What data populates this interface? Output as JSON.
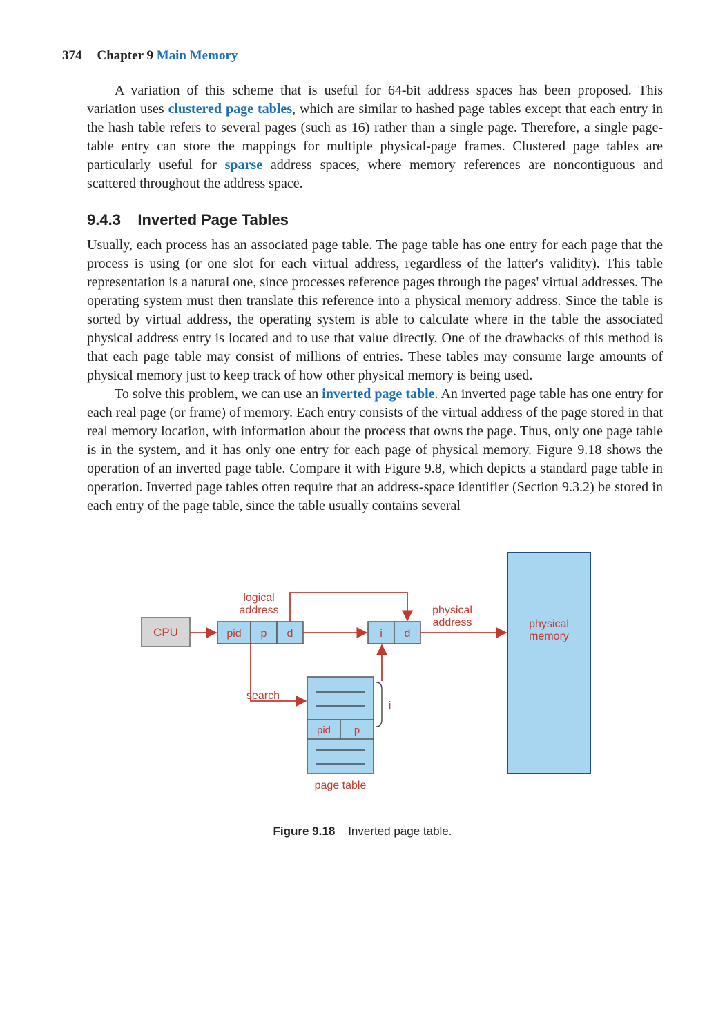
{
  "header": {
    "page_number": "374",
    "chapter_label": "Chapter 9",
    "chapter_title": "Main Memory"
  },
  "para1": {
    "t1": "A variation of this scheme that is useful for 64-bit address spaces has been proposed. This variation uses ",
    "term1": "clustered page tables",
    "t2": ", which are similar to hashed page tables except that each entry in the hash table refers to several pages (such as 16) rather than a single page. Therefore, a single page-table entry can store the mappings for multiple physical-page frames. Clustered page tables are particularly useful for ",
    "term2": "sparse",
    "t3": " address spaces, where memory references are noncontiguous and scattered throughout the address space."
  },
  "section": {
    "number": "9.4.3",
    "title": "Inverted Page Tables"
  },
  "para2": {
    "t1": "Usually, each process has an associated page table. The page table has one entry for each page that the process is using (or one slot for each virtual address, regardless of the latter's validity). This table representation is a natural one, since processes reference pages through the pages' virtual addresses. The operating system must then translate this reference into a physical memory address. Since the table is sorted by virtual address, the operating system is able to calculate where in the table the associated physical address entry is located and to use that value directly. One of the drawbacks of this method is that each page table may consist of millions of entries. These tables may consume large amounts of physical memory just to keep track of how other physical memory is being used."
  },
  "para3": {
    "t1": "To solve this problem, we can use an ",
    "term1": "inverted page table",
    "t2": ". An inverted page table has one entry for each real page (or frame) of memory. Each entry consists of the virtual address of the page stored in that real memory location, with information about the process that owns the page. Thus, only one page table is in the system, and it has only one entry for each page of physical memory. Figure 9.18 shows the operation of an inverted page table. Compare it with Figure 9.8, which depicts a standard page table in operation. Inverted page tables often require that an address-space identifier (Section 9.3.2) be stored in each entry of the page table, since the table usually contains several"
  },
  "figure": {
    "cpu": "CPU",
    "logical_address": "logical",
    "logical_address2": "address",
    "physical_address": "physical",
    "physical_address2": "address",
    "physical_memory": "physical",
    "physical_memory2": "memory",
    "pid": "pid",
    "p": "p",
    "d": "d",
    "i": "i",
    "search": "search",
    "page_table": "page table",
    "caption_label": "Figure 9.18",
    "caption_text": "Inverted page table."
  }
}
